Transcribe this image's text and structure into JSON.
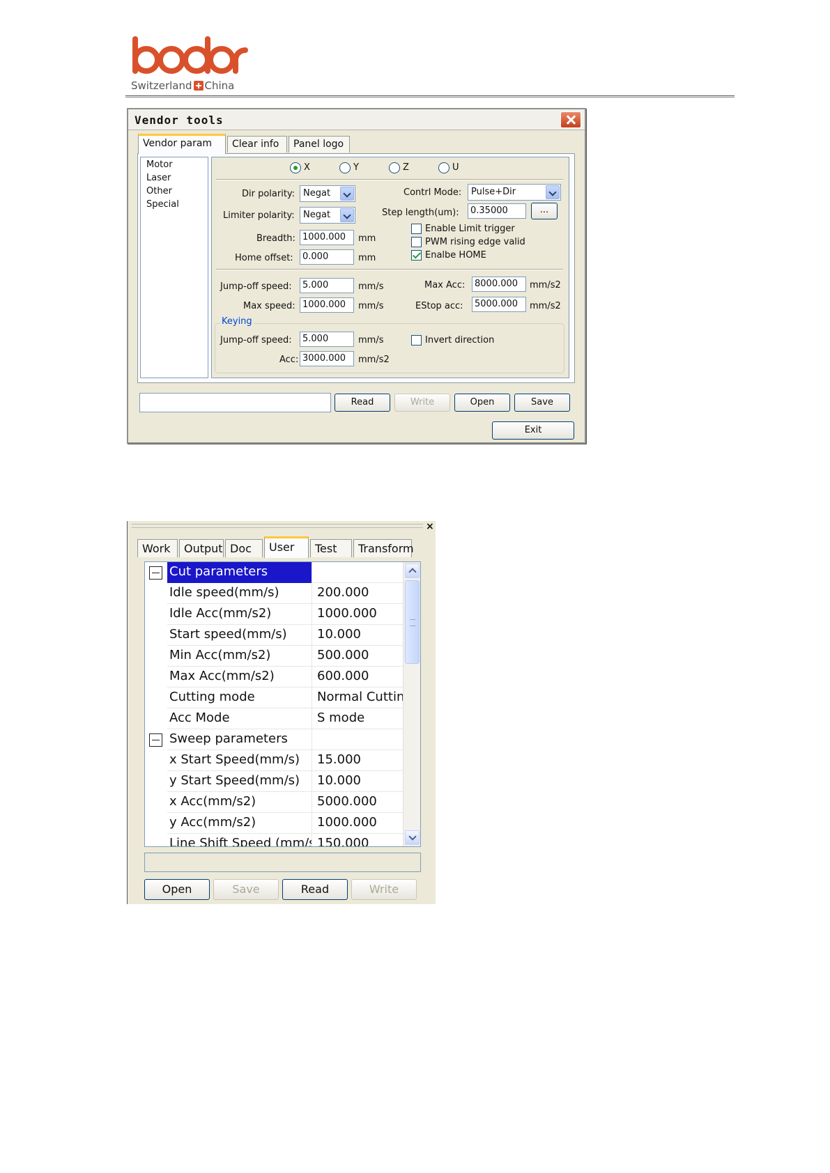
{
  "logo": {
    "wordmark": "bodor",
    "sub_left": "Switzerland",
    "sub_right": "China",
    "brand_color": "#d9512b"
  },
  "vendor_dialog": {
    "title": "Vendor tools",
    "tabs": [
      "Vendor param",
      "Clear info",
      "Panel logo"
    ],
    "active_tab": "Vendor param",
    "list": [
      "Motor",
      "Laser",
      "Other",
      "Special"
    ],
    "axes": [
      "X",
      "Y",
      "Z",
      "U"
    ],
    "selected_axis": "X",
    "dir_polarity": {
      "label": "Dir polarity:",
      "value": "Negat"
    },
    "limiter_polarity": {
      "label": "Limiter polarity:",
      "value": "Negat"
    },
    "breadth": {
      "label": "Breadth:",
      "value": "1000.000",
      "unit": "mm"
    },
    "home_offset": {
      "label": "Home offset:",
      "value": "0.000",
      "unit": "mm"
    },
    "contrl_mode": {
      "label": "Contrl Mode:",
      "value": "Pulse+Dir"
    },
    "step_length": {
      "label": "Step length(um):",
      "value": "0.35000",
      "browse": "..."
    },
    "checks": [
      {
        "label": "Enable Limit trigger",
        "checked": false
      },
      {
        "label": "PWM rising edge valid",
        "checked": false
      },
      {
        "label": "Enalbe HOME",
        "checked": true
      }
    ],
    "jump_off_speed": {
      "label": "Jump-off speed:",
      "value": "5.000",
      "unit": "mm/s"
    },
    "max_speed": {
      "label": "Max speed:",
      "value": "1000.000",
      "unit": "mm/s"
    },
    "max_acc": {
      "label": "Max Acc:",
      "value": "8000.000",
      "unit": "mm/s2"
    },
    "estop_acc": {
      "label": "EStop acc:",
      "value": "5000.000",
      "unit": "mm/s2"
    },
    "keying": {
      "title": "Keying",
      "jump_off_speed": {
        "label": "Jump-off speed:",
        "value": "5.000",
        "unit": "mm/s"
      },
      "acc": {
        "label": "Acc:",
        "value": "3000.000",
        "unit": "mm/s2"
      },
      "invert": {
        "label": "Invert direction",
        "checked": false
      }
    },
    "buttons": {
      "read": "Read",
      "write": "Write",
      "open": "Open",
      "save": "Save",
      "exit": "Exit"
    }
  },
  "user_panel": {
    "close": "×",
    "tabs": [
      "Work",
      "Output",
      "Doc",
      "User",
      "Test",
      "Transform"
    ],
    "active_tab": "User",
    "rows": [
      {
        "type": "category",
        "name": "Cut parameters",
        "value": "",
        "selected": true
      },
      {
        "type": "param",
        "name": "Idle speed(mm/s)",
        "value": "200.000"
      },
      {
        "type": "param",
        "name": "Idle Acc(mm/s2)",
        "value": "1000.000"
      },
      {
        "type": "param",
        "name": "Start speed(mm/s)",
        "value": "10.000"
      },
      {
        "type": "param",
        "name": "Min Acc(mm/s2)",
        "value": "500.000"
      },
      {
        "type": "param",
        "name": "Max Acc(mm/s2)",
        "value": "600.000"
      },
      {
        "type": "param",
        "name": "Cutting mode",
        "value": "Normal Cutting"
      },
      {
        "type": "param",
        "name": "Acc Mode",
        "value": "S mode"
      },
      {
        "type": "category",
        "name": "Sweep parameters",
        "value": "",
        "selected": false
      },
      {
        "type": "param",
        "name": "x Start Speed(mm/s)",
        "value": "15.000"
      },
      {
        "type": "param",
        "name": "y Start Speed(mm/s)",
        "value": "10.000"
      },
      {
        "type": "param",
        "name": "x Acc(mm/s2)",
        "value": "5000.000"
      },
      {
        "type": "param",
        "name": "y Acc(mm/s2)",
        "value": "1000.000"
      },
      {
        "type": "param",
        "name": "Line Shift Speed (mm/s)",
        "value": "150.000"
      }
    ],
    "buttons": {
      "open": "Open",
      "save": "Save",
      "read": "Read",
      "write": "Write"
    }
  }
}
